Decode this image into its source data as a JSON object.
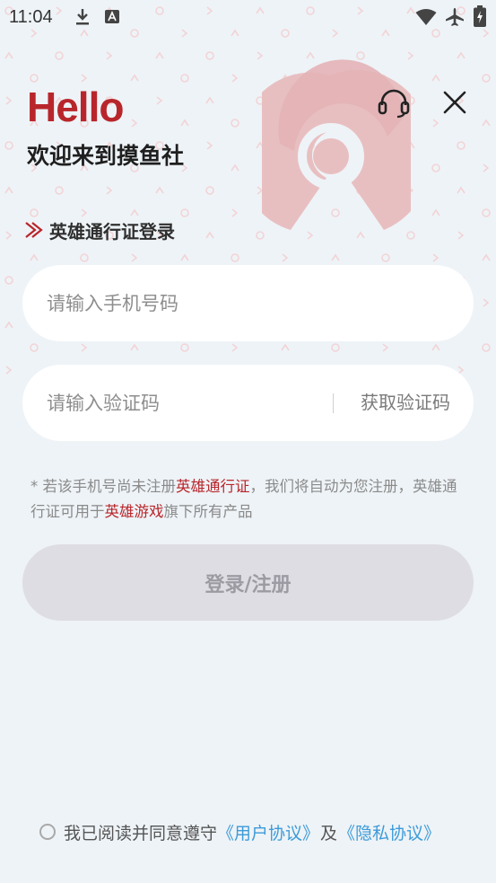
{
  "status_bar": {
    "time": "11:04",
    "left_icons": [
      "download-icon",
      "text-input-icon"
    ],
    "right_icons": [
      "wifi-icon",
      "airplane-icon",
      "battery-icon"
    ]
  },
  "header": {
    "hello": "Hello",
    "welcome": "欢迎来到摸鱼社",
    "support_icon": "headset-icon",
    "close_icon": "close-icon"
  },
  "login": {
    "section_title": "英雄通行证登录",
    "phone_placeholder": "请输入手机号码",
    "code_placeholder": "请输入验证码",
    "get_code_label": "获取验证码",
    "submit_label": "登录/注册"
  },
  "notice": {
    "part1": "* 若该手机号尚未注册",
    "highlight1": "英雄通行证",
    "part2": "，我们将自动为您注册，英雄通行证可用于",
    "highlight2": "英雄游戏",
    "part3": "旗下所有产品"
  },
  "agreement": {
    "prefix": "我已阅读并同意遵守",
    "user_agreement": "《用户协议》",
    "conjunction": "及",
    "privacy_policy": "《隐私协议》",
    "checked": false
  },
  "colors": {
    "brand_red": "#b8262b",
    "link_blue": "#3d9bd8",
    "background": "#eef3f7",
    "button_disabled": "#dedde3"
  }
}
